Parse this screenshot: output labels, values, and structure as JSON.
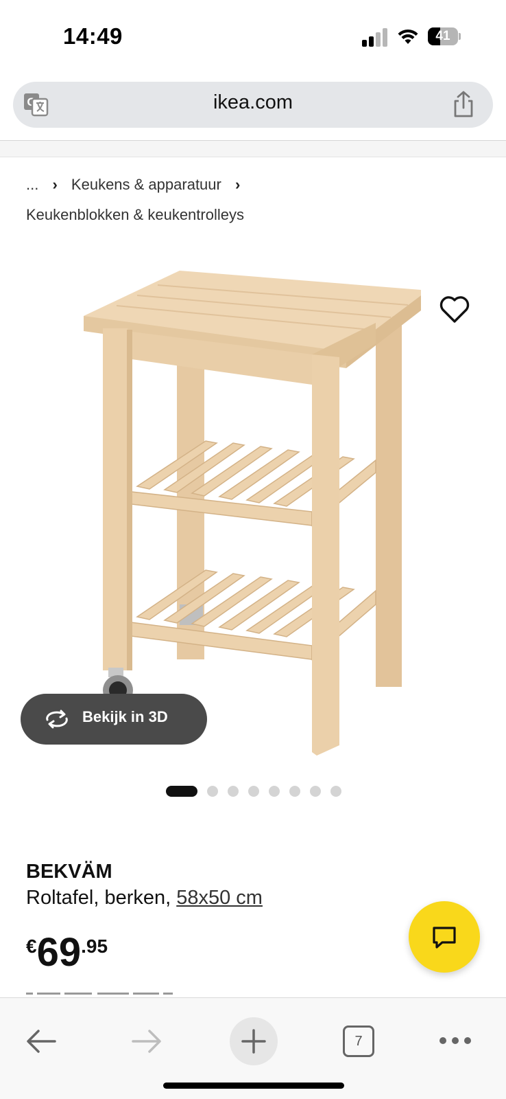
{
  "status_bar": {
    "time": "14:49",
    "battery_level": "41",
    "signal_bars_active": 2,
    "signal_bars_total": 4
  },
  "browser": {
    "url": "ikea.com",
    "translate_icon": "translate-icon",
    "share_icon": "share-icon",
    "open_tabs": "7"
  },
  "breadcrumb": {
    "ellipsis": "...",
    "level1": "Keukens & apparatuur",
    "level2": "Keukenblokken & keukentrolleys"
  },
  "product_image": {
    "view_3d_label": "Bekijk in 3D",
    "carousel_total": 8,
    "carousel_active": 1
  },
  "product": {
    "name": "BEKVÄM",
    "description": "Roltafel, berken, ",
    "size": "58x50 cm",
    "price_currency": "€",
    "price_whole": "69",
    "price_decimal": ".95"
  },
  "colors": {
    "accent_yellow": "#f9d81b",
    "view3d_bg": "#4a4a4a",
    "url_bar_bg": "#e4e6e9"
  }
}
